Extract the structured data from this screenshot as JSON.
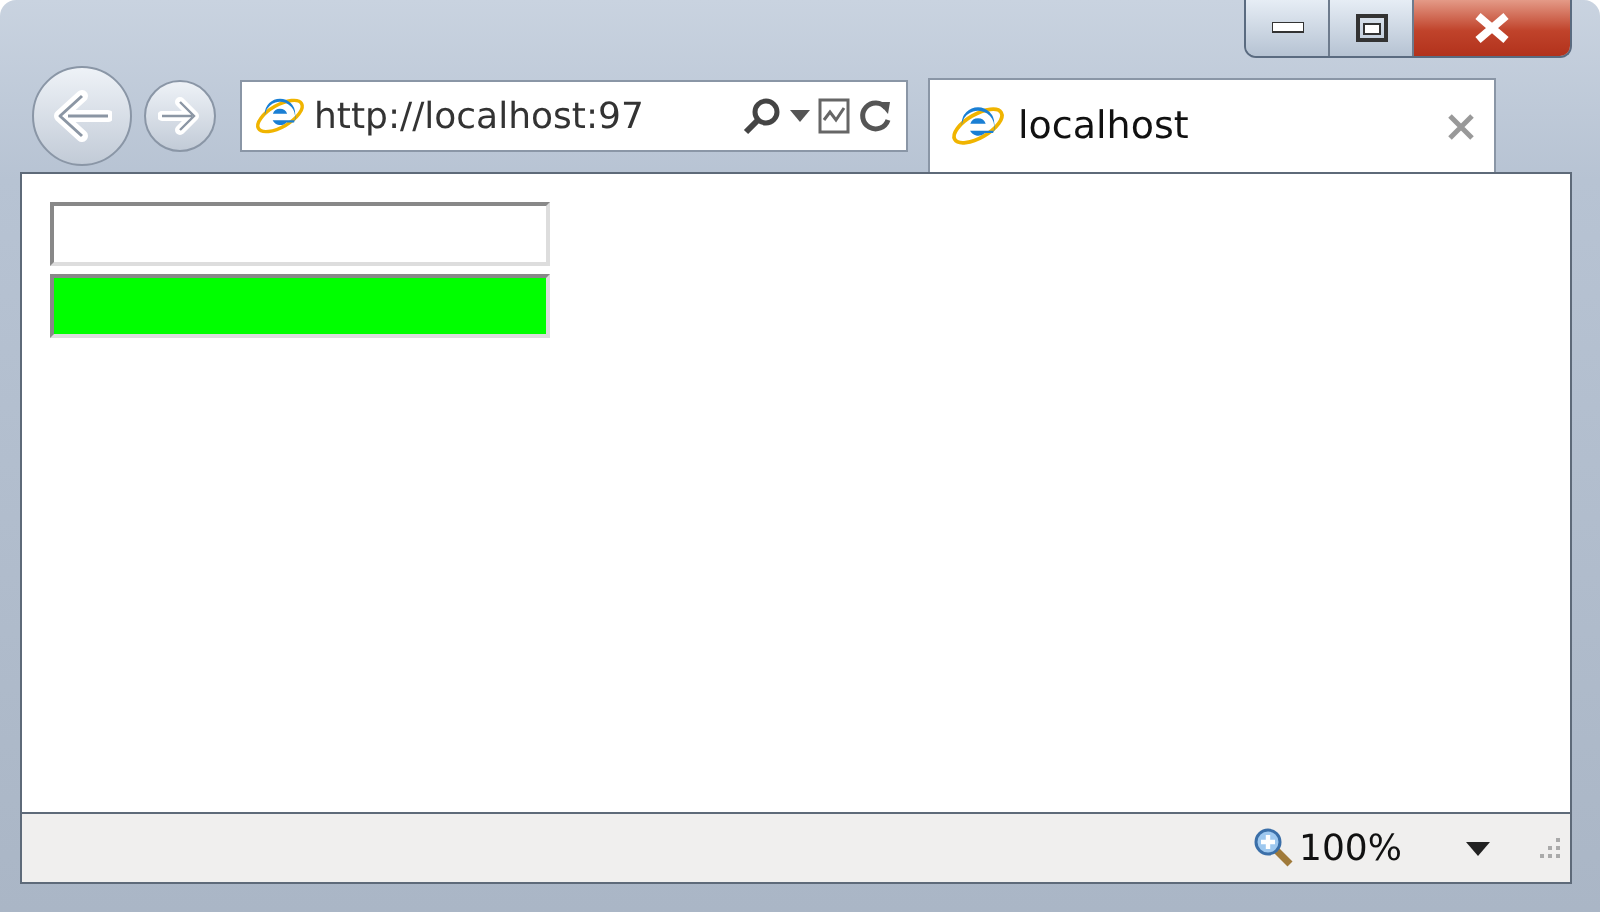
{
  "address_bar": {
    "url": "http://localhost:97"
  },
  "tabs": [
    {
      "title": "localhost",
      "selected": true
    }
  ],
  "fields": [
    {
      "kind": "text",
      "color": "#ffffff"
    },
    {
      "kind": "text",
      "color": "#00ff00"
    }
  ],
  "status_bar": {
    "zoom": "100%"
  }
}
